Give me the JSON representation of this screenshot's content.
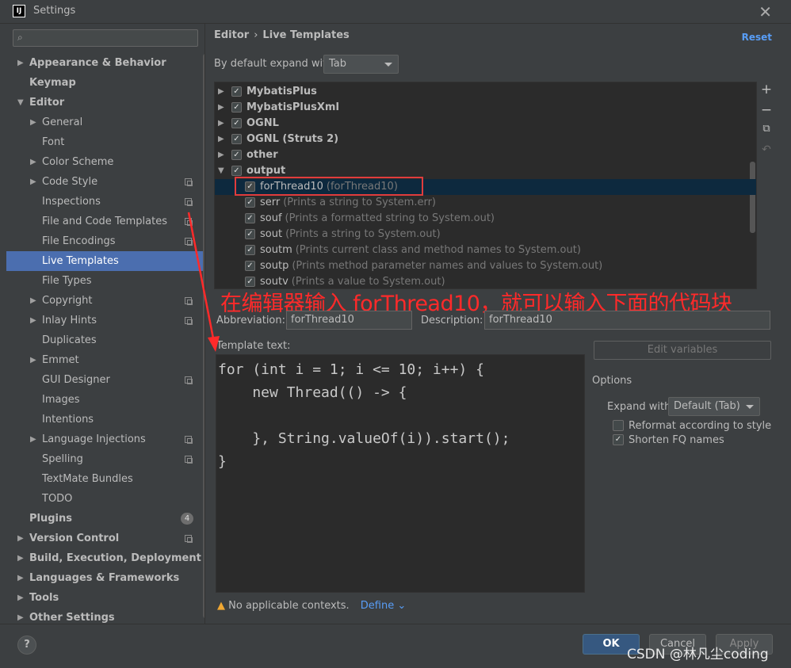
{
  "window": {
    "title": "Settings",
    "app_icon": "IJ"
  },
  "sidebar": {
    "items": [
      {
        "label": "Appearance & Behavior",
        "level": 0,
        "bold": true,
        "arrow": "▶"
      },
      {
        "label": "Keymap",
        "level": 0,
        "bold": true,
        "arrow": ""
      },
      {
        "label": "Editor",
        "level": 0,
        "bold": true,
        "arrow": "▼"
      },
      {
        "label": "General",
        "level": 1,
        "arrow": "▶"
      },
      {
        "label": "Font",
        "level": 1,
        "arrow": ""
      },
      {
        "label": "Color Scheme",
        "level": 1,
        "arrow": "▶"
      },
      {
        "label": "Code Style",
        "level": 1,
        "arrow": "▶",
        "copy": true
      },
      {
        "label": "Inspections",
        "level": 1,
        "arrow": "",
        "copy": true
      },
      {
        "label": "File and Code Templates",
        "level": 1,
        "arrow": "",
        "copy": true
      },
      {
        "label": "File Encodings",
        "level": 1,
        "arrow": "",
        "copy": true
      },
      {
        "label": "Live Templates",
        "level": 1,
        "arrow": "",
        "selected": true
      },
      {
        "label": "File Types",
        "level": 1,
        "arrow": ""
      },
      {
        "label": "Copyright",
        "level": 1,
        "arrow": "▶",
        "copy": true
      },
      {
        "label": "Inlay Hints",
        "level": 1,
        "arrow": "▶",
        "copy": true
      },
      {
        "label": "Duplicates",
        "level": 1,
        "arrow": ""
      },
      {
        "label": "Emmet",
        "level": 1,
        "arrow": "▶"
      },
      {
        "label": "GUI Designer",
        "level": 1,
        "arrow": "",
        "copy": true
      },
      {
        "label": "Images",
        "level": 1,
        "arrow": ""
      },
      {
        "label": "Intentions",
        "level": 1,
        "arrow": ""
      },
      {
        "label": "Language Injections",
        "level": 1,
        "arrow": "▶",
        "copy": true
      },
      {
        "label": "Spelling",
        "level": 1,
        "arrow": "",
        "copy": true
      },
      {
        "label": "TextMate Bundles",
        "level": 1,
        "arrow": ""
      },
      {
        "label": "TODO",
        "level": 1,
        "arrow": ""
      },
      {
        "label": "Plugins",
        "level": 0,
        "bold": true,
        "arrow": "",
        "badge": "4"
      },
      {
        "label": "Version Control",
        "level": 0,
        "bold": true,
        "arrow": "▶",
        "copy": true
      },
      {
        "label": "Build, Execution, Deployment",
        "level": 0,
        "bold": true,
        "arrow": "▶"
      },
      {
        "label": "Languages & Frameworks",
        "level": 0,
        "bold": true,
        "arrow": "▶"
      },
      {
        "label": "Tools",
        "level": 0,
        "bold": true,
        "arrow": "▶"
      },
      {
        "label": "Other Settings",
        "level": 0,
        "bold": true,
        "arrow": "▶"
      }
    ]
  },
  "main": {
    "breadcrumb": [
      "Editor",
      "Live Templates"
    ],
    "reset_label": "Reset",
    "expand_label": "By default expand with",
    "expand_value": "Tab",
    "templates": [
      {
        "kind": "group",
        "name": "MybatisPlus",
        "arrow": "▶"
      },
      {
        "kind": "group",
        "name": "MybatisPlusXml",
        "arrow": "▶"
      },
      {
        "kind": "group",
        "name": "OGNL",
        "arrow": "▶"
      },
      {
        "kind": "group",
        "name": "OGNL (Struts 2)",
        "arrow": "▶"
      },
      {
        "kind": "group",
        "name": "other",
        "arrow": "▶"
      },
      {
        "kind": "group",
        "name": "output",
        "arrow": "▼"
      },
      {
        "kind": "item",
        "name": "forThread10",
        "desc": "(forThread10)",
        "selected": true
      },
      {
        "kind": "item",
        "name": "serr",
        "desc": "(Prints a string to System.err)"
      },
      {
        "kind": "item",
        "name": "souf",
        "desc": "(Prints a formatted string to System.out)"
      },
      {
        "kind": "item",
        "name": "sout",
        "desc": "(Prints a string to System.out)"
      },
      {
        "kind": "item",
        "name": "soutm",
        "desc": "(Prints current class and method names to System.out)"
      },
      {
        "kind": "item",
        "name": "soutp",
        "desc": "(Prints method parameter names and values to System.out)"
      },
      {
        "kind": "item",
        "name": "soutv",
        "desc": "(Prints a value to System.out)"
      }
    ],
    "annotation": "在编辑器输入 forThread10，就可以输入下面的代码块",
    "abbreviation_label": "Abbreviation:",
    "abbreviation_value": "forThread10",
    "description_label": "Description:",
    "description_value": "forThread10",
    "template_text_label": "Template text:",
    "template_text": "for (int i = 1; i <= 10; i++) {\n    new Thread(() -> {\n\n    }, String.valueOf(i)).start();\n}",
    "edit_variables_label": "Edit variables",
    "options_title": "Options",
    "expand_with_label": "Expand with",
    "expand_with_value": "Default (Tab)",
    "reformat_label": "Reformat according to style",
    "reformat_checked": false,
    "shorten_label": "Shorten FQ names",
    "shorten_checked": true,
    "warning_text": "No applicable contexts.",
    "define_label": "Define ⌄"
  },
  "footer": {
    "help_label": "?",
    "ok_label": "OK",
    "cancel_label": "Cancel",
    "apply_label": "Apply",
    "watermark": "CSDN @林凡尘coding"
  },
  "colors": {
    "accent": "#4b6eaf",
    "annotation": "#ff2a2a",
    "link": "#589df6"
  }
}
